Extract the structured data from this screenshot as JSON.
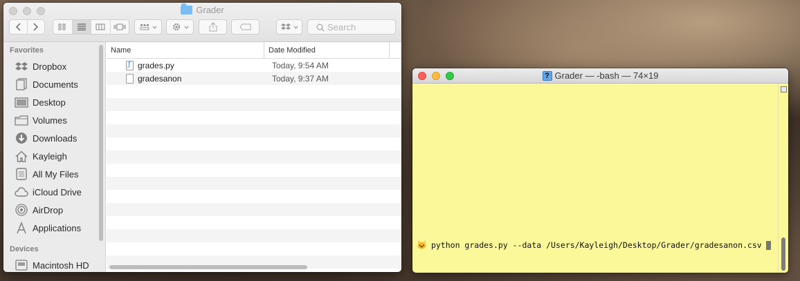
{
  "finder": {
    "title": "Grader",
    "search_placeholder": "Search",
    "sidebar": {
      "favorites_heading": "Favorites",
      "items": [
        {
          "label": "Dropbox",
          "icon": "dropbox-icon"
        },
        {
          "label": "Documents",
          "icon": "documents-icon"
        },
        {
          "label": "Desktop",
          "icon": "desktop-icon"
        },
        {
          "label": "Volumes",
          "icon": "folder-icon"
        },
        {
          "label": "Downloads",
          "icon": "downloads-icon"
        },
        {
          "label": "Kayleigh",
          "icon": "home-icon"
        },
        {
          "label": "All My Files",
          "icon": "all-files-icon"
        },
        {
          "label": "iCloud Drive",
          "icon": "cloud-icon"
        },
        {
          "label": "AirDrop",
          "icon": "airdrop-icon"
        },
        {
          "label": "Applications",
          "icon": "applications-icon"
        }
      ],
      "devices_heading": "Devices",
      "devices": [
        {
          "label": "Macintosh HD",
          "icon": "harddrive-icon"
        }
      ]
    },
    "columns": {
      "name": "Name",
      "date_modified": "Date Modified"
    },
    "files": [
      {
        "name": "grades.py",
        "date": "Today, 9:54 AM",
        "icon": "python-file-icon"
      },
      {
        "name": "gradesanon",
        "date": "Today, 9:37 AM",
        "icon": "document-icon"
      }
    ]
  },
  "terminal": {
    "title": "Grader — -bash — 74×19",
    "command": "python grades.py --data /Users/Kayleigh/Desktop/Grader/gradesanon.csv",
    "prompt_icon": "🐱",
    "background": "#fbf89a"
  }
}
